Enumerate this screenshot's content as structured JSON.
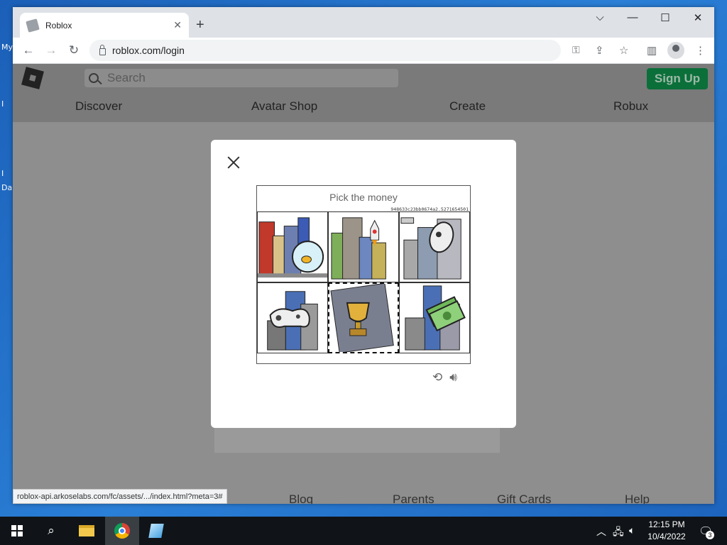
{
  "desktop": {
    "icon_labels": [
      "My",
      "I",
      "I",
      "Da"
    ]
  },
  "browser": {
    "tab_title": "Roblox",
    "tab_close": "✕",
    "new_tab": "+",
    "window_controls": {
      "dropdown": "⌵",
      "minimize": "—",
      "maximize": "☐",
      "close": "✕"
    },
    "url": "roblox.com/login",
    "status_url": "roblox-api.arkoselabs.com/fc/assets/.../index.html?meta=3#"
  },
  "roblox": {
    "search_placeholder": "Search",
    "signup_label": "Sign Up",
    "nav": [
      "Discover",
      "Avatar Shop",
      "Create",
      "Robux"
    ],
    "footer": [
      "Blog",
      "Parents",
      "Gift Cards",
      "Help"
    ]
  },
  "captcha": {
    "prompt": "Pick the money",
    "session_id": "948633c23bb0674a2.5271654501",
    "cells": [
      {
        "name": "fishbowl",
        "selected": false
      },
      {
        "name": "rocket",
        "selected": false
      },
      {
        "name": "robot",
        "selected": false
      },
      {
        "name": "gamepad",
        "selected": false
      },
      {
        "name": "trophy",
        "selected": true
      },
      {
        "name": "money",
        "selected": false
      }
    ]
  },
  "taskbar": {
    "time": "12:15 PM",
    "date": "10/4/2022",
    "notification_count": "3"
  },
  "colors": {
    "signup_green": "#0b6f3a",
    "taskbar": "#101418"
  }
}
